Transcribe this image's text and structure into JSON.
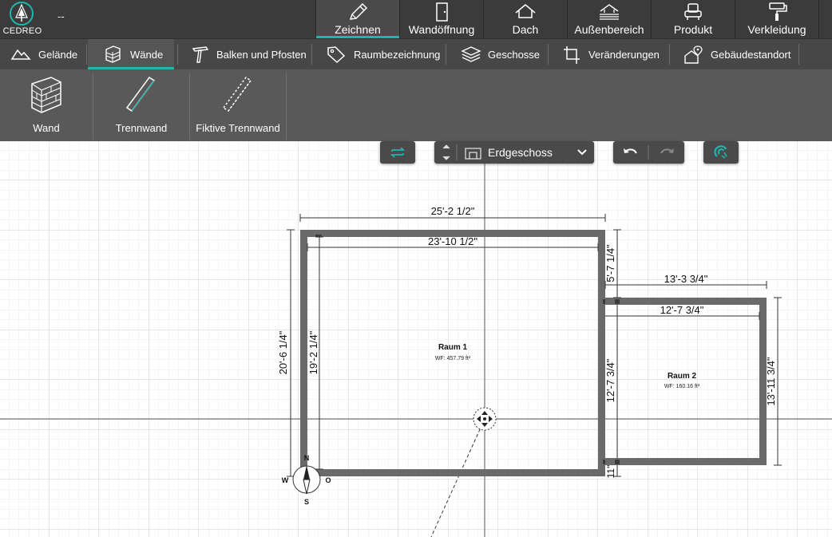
{
  "app": {
    "logo_text": "CEDREO",
    "project_name": "--",
    "accent_color": "#1fb5b0"
  },
  "main_tabs": [
    {
      "label": "Zeichnen",
      "icon": "pencil-icon",
      "active": true
    },
    {
      "label": "Wandöffnung",
      "icon": "door-icon",
      "active": false
    },
    {
      "label": "Dach",
      "icon": "roof-icon",
      "active": false
    },
    {
      "label": "Außenbereich",
      "icon": "deck-icon",
      "active": false
    },
    {
      "label": "Produkt",
      "icon": "armchair-icon",
      "active": false
    },
    {
      "label": "Verkleidung",
      "icon": "paint-roller-icon",
      "active": false
    }
  ],
  "sub_tabs": [
    {
      "label": "Gelände",
      "icon": "terrain-icon"
    },
    {
      "label": "Wände",
      "icon": "brick-wall-icon",
      "active": true
    },
    {
      "label": "Balken und Pfosten",
      "icon": "beam-icon"
    },
    {
      "label": "Raumbezeichnung",
      "icon": "tag-icon"
    },
    {
      "label": "Geschosse",
      "icon": "layers-icon"
    },
    {
      "label": "Veränderungen",
      "icon": "crop-icon"
    },
    {
      "label": "Gebäudestandort",
      "icon": "house-location-icon"
    }
  ],
  "tools": [
    {
      "label": "Wand",
      "icon": "brick-wall-icon"
    },
    {
      "label": "Trennwand",
      "icon": "partition-icon"
    },
    {
      "label": "Fiktive Trennwand",
      "icon": "dashed-partition-icon"
    }
  ],
  "floor_selector": {
    "value": "Erdgeschoss"
  },
  "plan": {
    "rooms": [
      {
        "name": "Raum 1",
        "area": "WF: 457.79 ft²"
      },
      {
        "name": "Raum 2",
        "area": "WF: 160.16 ft²"
      }
    ],
    "dimensions": {
      "top_outer": "25'-2 1/2\"",
      "top_inner": "23'-10 1/2\"",
      "left_outer": "20'-6 1/4\"",
      "left_inner": "19'-2 1/4\"",
      "right_upper": "5'-7 1/4\"",
      "right_room1_inner": "12'-7 3/4\"",
      "right_bottom": "11\"",
      "room2_top_outer": "13'-3 3/4\"",
      "room2_top_inner": "12'-7 3/4\"",
      "room2_right_outer": "13'-11 3/4\""
    },
    "compass": {
      "n": "N",
      "s": "S",
      "w": "W",
      "o": "O"
    }
  }
}
